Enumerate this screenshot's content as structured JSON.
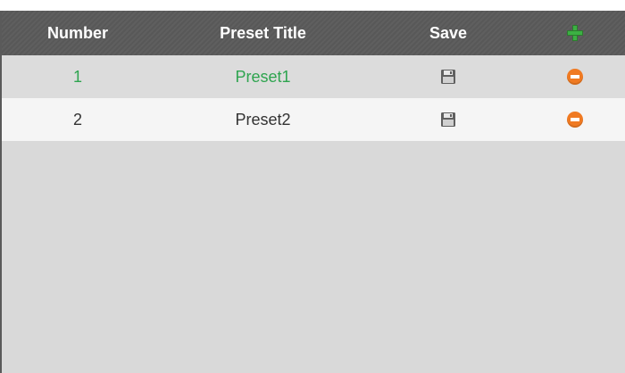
{
  "table": {
    "headers": {
      "number": "Number",
      "preset_title": "Preset Title",
      "save": "Save"
    },
    "add_icon": "plus-icon",
    "rows": [
      {
        "number": "1",
        "title": "Preset1",
        "save_icon": "floppy-disk-icon",
        "delete_icon": "minus-circle-icon",
        "selected": true
      },
      {
        "number": "2",
        "title": "Preset2",
        "save_icon": "floppy-disk-icon",
        "delete_icon": "minus-circle-icon",
        "selected": false
      }
    ]
  },
  "colors": {
    "selected_text": "#2ea44f",
    "add_icon": "#3cb043",
    "delete_icon": "#f07a22",
    "header_bg": "#5b5b5b",
    "panel_bg": "#d9d9d9"
  }
}
